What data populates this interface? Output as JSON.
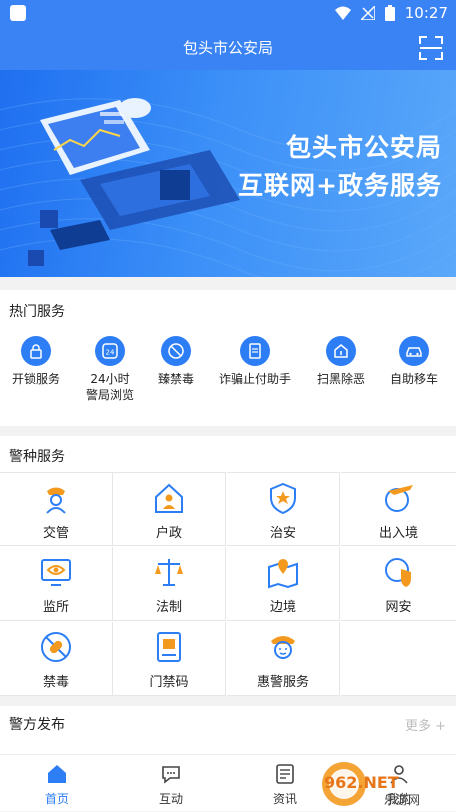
{
  "status": {
    "time": "10:27"
  },
  "appbar": {
    "title": "包头市公安局"
  },
  "banner": {
    "line1": "包头市公安局",
    "line2": "互联网+政务服务"
  },
  "hot": {
    "title": "热门服务",
    "items": [
      {
        "label": "开锁服务",
        "icon": "lock-icon"
      },
      {
        "label": "24小时\n警局浏览",
        "icon": "24h-icon"
      },
      {
        "label": "臻禁毒",
        "icon": "no-drugs-icon"
      },
      {
        "label": "诈骗止付助手",
        "icon": "document-icon"
      },
      {
        "label": "扫黑除恶",
        "icon": "house-icon"
      },
      {
        "label": "自助移车",
        "icon": "car-icon"
      }
    ]
  },
  "police": {
    "title": "警种服务",
    "items": [
      {
        "label": "交管",
        "icon": "traffic-police-icon"
      },
      {
        "label": "户政",
        "icon": "household-icon"
      },
      {
        "label": "治安",
        "icon": "badge-icon"
      },
      {
        "label": "出入境",
        "icon": "airplane-icon"
      },
      {
        "label": "监所",
        "icon": "monitor-eye-icon"
      },
      {
        "label": "法制",
        "icon": "scales-icon"
      },
      {
        "label": "边境",
        "icon": "map-pin-icon"
      },
      {
        "label": "网安",
        "icon": "shield-globe-icon"
      },
      {
        "label": "禁毒",
        "icon": "no-drugs-icon"
      },
      {
        "label": "门禁码",
        "icon": "card-icon"
      },
      {
        "label": "惠警服务",
        "icon": "officer-icon"
      }
    ]
  },
  "notices": {
    "title": "警方发布",
    "more": "更多 +"
  },
  "tabs": [
    {
      "label": "首页",
      "icon": "home-icon",
      "active": true
    },
    {
      "label": "互动",
      "icon": "chat-icon"
    },
    {
      "label": "资讯",
      "icon": "news-icon"
    },
    {
      "label": "我的",
      "icon": "user-icon"
    }
  ],
  "watermark": "962.NET 乐游网",
  "colors": {
    "primary": "#2d7ef4",
    "header": "#3a83f5",
    "accent": "#f39a1e"
  }
}
